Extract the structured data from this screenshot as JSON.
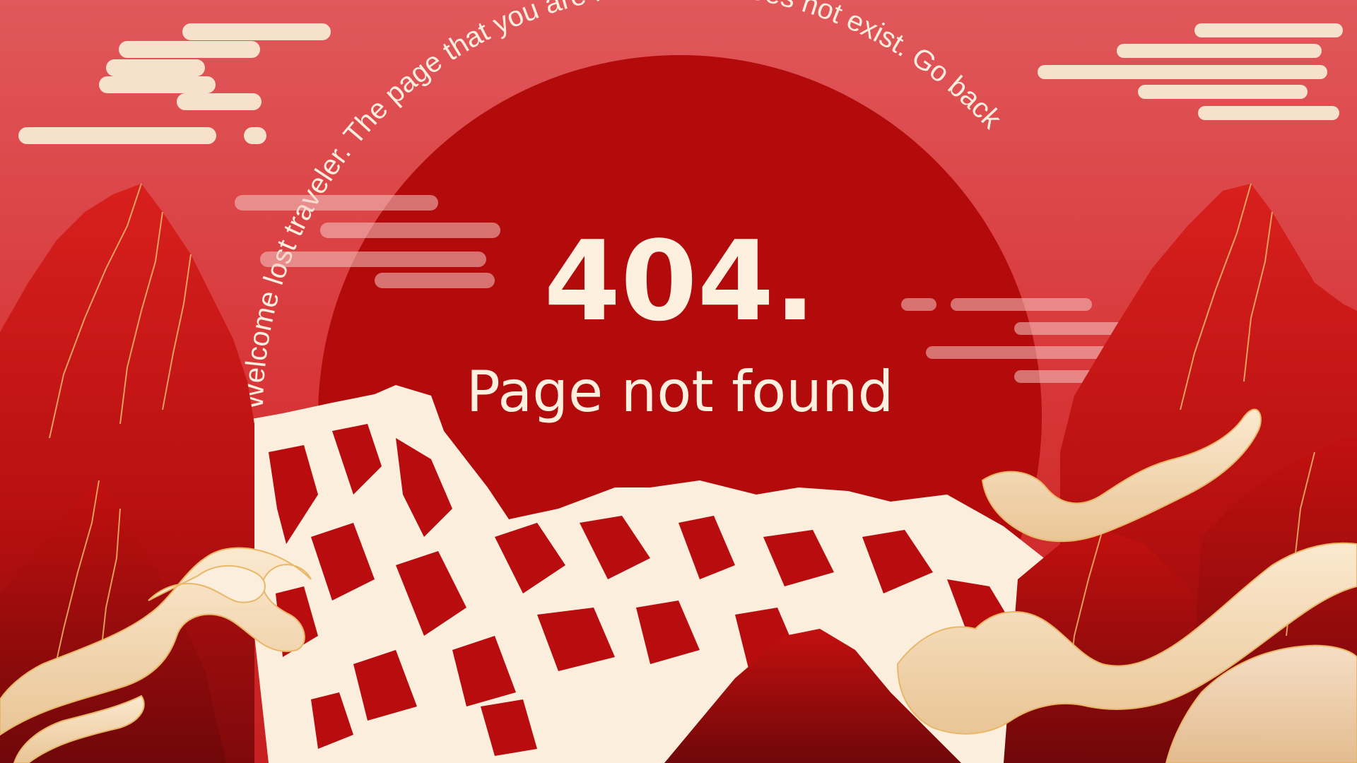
{
  "page": {
    "error_code": "404.",
    "subtitle": "Page not found"
  },
  "arc_message": {
    "text": "Welcome lost traveler. The page that you are looking for does not exist. ",
    "link_label": "Go back"
  },
  "colors": {
    "sky_top": "#dc4a4e",
    "sky_bottom": "#d42a2c",
    "sun": "#b30a0c",
    "mountain_red": "#c8110f",
    "mountain_dark": "#8e0b0d",
    "snow_cream": "#fbeedd",
    "cloud_cream": "#f6dfc4",
    "gold_line": "#e8b768"
  }
}
